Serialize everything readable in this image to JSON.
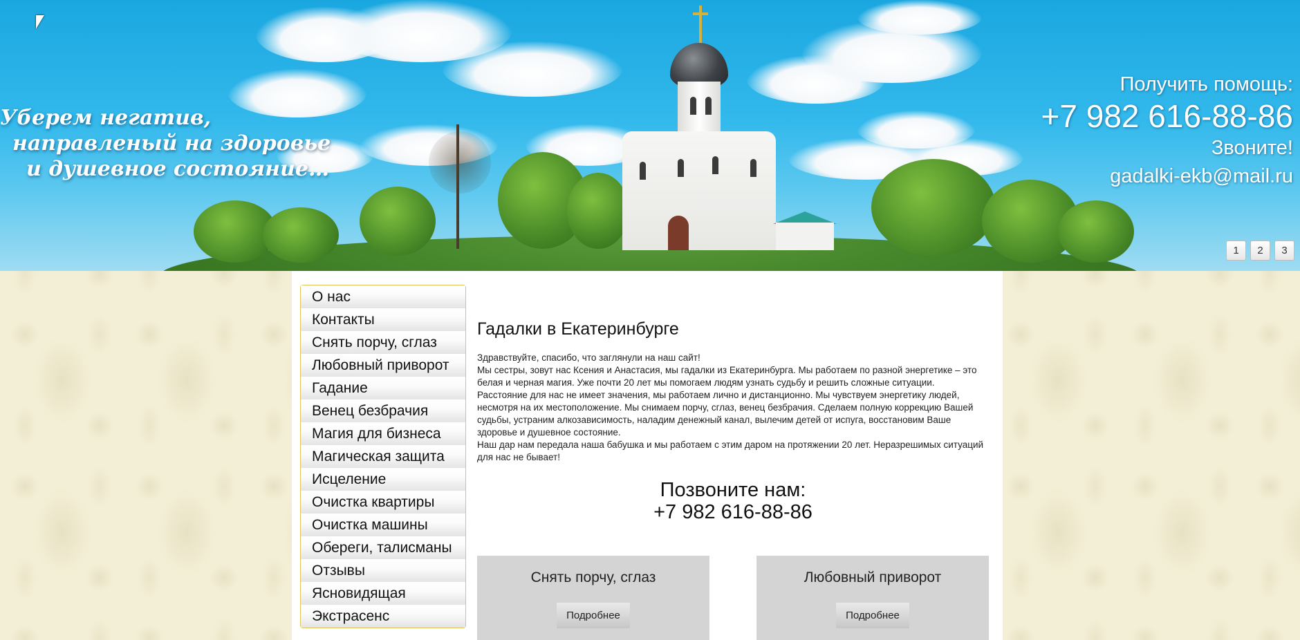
{
  "banner": {
    "slogan": {
      "line1": "Уберем негатив,",
      "line2": "направленый на здоровье",
      "line3": "и душевное состояние…"
    },
    "contact": {
      "help_label": "Получить помощь:",
      "phone": "+7 982 616-88-86",
      "call_label": "Звоните!",
      "email": "gadalki-ekb@mail.ru"
    },
    "slider_pages": [
      "1",
      "2",
      "3"
    ]
  },
  "nav": {
    "items": [
      {
        "label": "О нас"
      },
      {
        "label": "Контакты"
      },
      {
        "label": "Снять порчу, сглаз"
      },
      {
        "label": "Любовный приворот"
      },
      {
        "label": "Гадание"
      },
      {
        "label": "Венец безбрачия"
      },
      {
        "label": "Магия для бизнеса"
      },
      {
        "label": "Магическая защита"
      },
      {
        "label": "Исцеление"
      },
      {
        "label": "Очистка квартиры"
      },
      {
        "label": "Очистка машины"
      },
      {
        "label": "Обереги, талисманы"
      },
      {
        "label": "Отзывы"
      },
      {
        "label": "Ясновидящая"
      },
      {
        "label": "Экстрасенс"
      }
    ]
  },
  "content": {
    "title": "Гадалки в Екатеринбурге",
    "paragraphs": [
      "Здравствуйте, спасибо, что заглянули на наш сайт!",
      "Мы сестры, зовут нас Ксения и Анастасия, мы гадалки из Екатеринбурга. Мы работаем по разной энергетике – это белая и черная магия. Уже почти 20 лет мы помогаем людям узнать судьбу и решить сложные ситуации.",
      "Расстояние для нас не имеет значения, мы работаем лично и дистанционно. Мы чувствуем энергетику людей, несмотря на их местоположение. Мы снимаем порчу, сглаз, венец безбрачия. Сделаем полную коррекцию Вашей судьбы, устраним алкозависимость, наладим денежный канал, вылечим детей от испуга, восстановим Ваше здоровье и душевное состояние.",
      "Наш дар нам передала наша бабушка и мы работаем с этим даром на протяжении 20 лет. Неразрешимых ситуаций для нас не бывает!"
    ],
    "call_us": {
      "label": "Позвоните нам:",
      "phone": "+7 982 616-88-86"
    },
    "cards": [
      {
        "title": "Снять порчу, сглаз",
        "button": "Подробнее"
      },
      {
        "title": "Любовный приворот",
        "button": "Подробнее"
      }
    ]
  }
}
